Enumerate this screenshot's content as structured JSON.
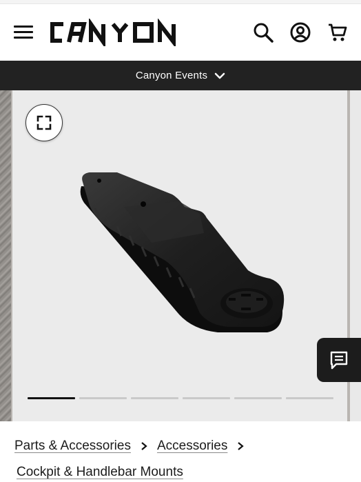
{
  "header": {
    "logo_text": "CANYON",
    "menu_icon": "hamburger-menu-icon",
    "icons": [
      "search-icon",
      "account-icon",
      "cart-icon"
    ]
  },
  "events_bar": {
    "label": "Canyon Events",
    "icon": "chevron-down-icon"
  },
  "gallery": {
    "expand_icon": "fullscreen-expand-icon",
    "image_alt": "black handlebar mount bracket",
    "slide_count": 6,
    "active_slide": 1
  },
  "chat": {
    "icon": "chat-message-icon"
  },
  "breadcrumb": {
    "items": [
      "Parts & Accessories",
      "Accessories",
      "Cockpit & Handlebar Mounts"
    ],
    "separator_icon": "chevron-right-icon"
  },
  "colors": {
    "bar_bg": "#222222",
    "accent": "#111111",
    "card_bg": "#ebebeb"
  }
}
